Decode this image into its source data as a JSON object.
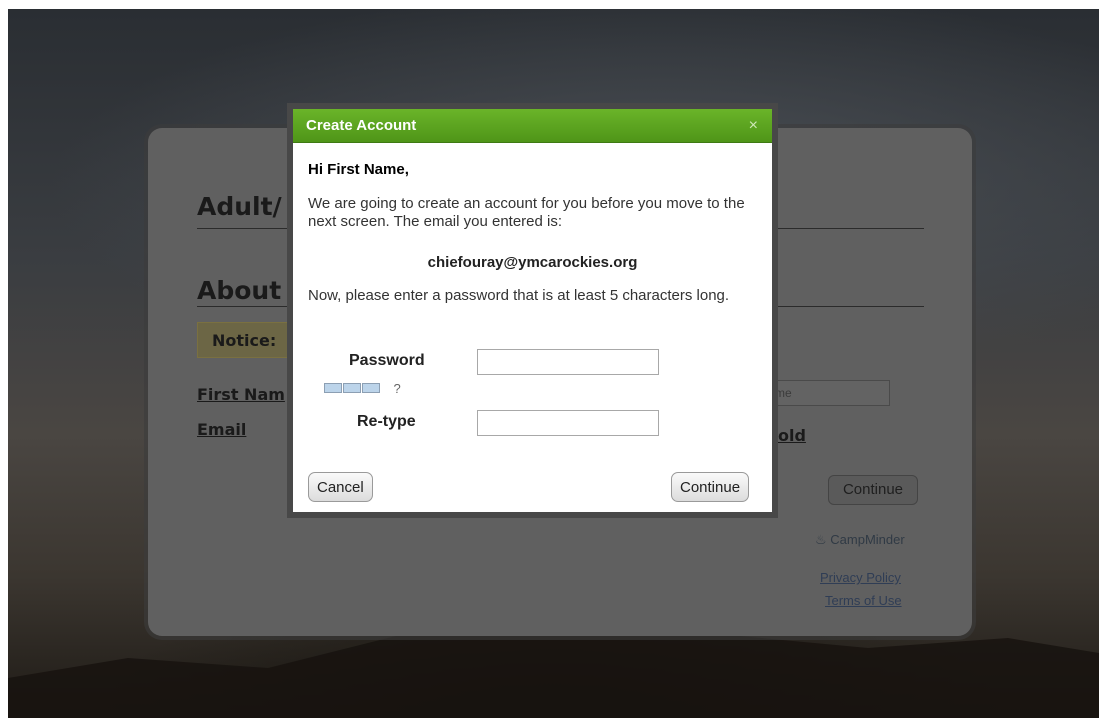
{
  "background": {
    "title_partial": "Adult/",
    "section_partial": "About Y",
    "notice_partial": "Notice:",
    "first_name_partial": "First Nam",
    "email_label": "Email",
    "input_placeholder_partial": "me",
    "household_partial": "old",
    "continue_label": "Continue",
    "logo_text": "CampMinder",
    "privacy_link": "Privacy Policy",
    "terms_link": "Terms of Use"
  },
  "modal": {
    "title": "Create Account",
    "close_glyph": "×",
    "greeting": "Hi First Name,",
    "intro": "We are going to create an account for you before you move to the next screen. The email you entered is:",
    "email": "chiefouray@ymcarockies.org",
    "password_prompt": "Now, please enter a password that is at least 5 characters long.",
    "password_label": "Password",
    "strength_hint": "?",
    "retype_label": "Re-type",
    "password_value": "",
    "retype_value": "",
    "cancel_label": "Cancel",
    "continue_label": "Continue"
  },
  "colors": {
    "header_green": "#5aa51f",
    "overlay_gray": "#606060"
  }
}
